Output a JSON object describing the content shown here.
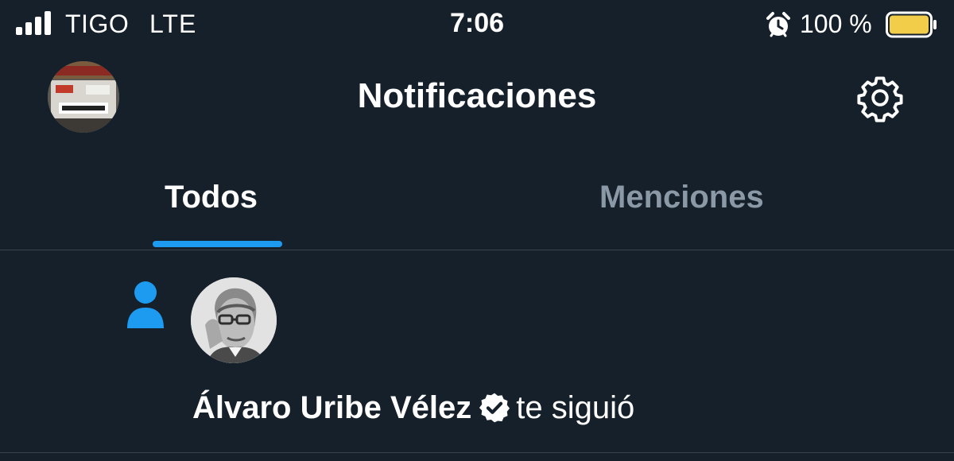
{
  "status_bar": {
    "carrier": "TIGO",
    "network": "LTE",
    "time": "7:06",
    "battery_percent": "100 %",
    "icons": [
      "signal-icon",
      "alarm-icon",
      "battery-icon"
    ]
  },
  "header": {
    "title": "Notificaciones",
    "avatar_icon": "profile-avatar",
    "settings_icon": "gear-icon"
  },
  "tabs": [
    {
      "label": "Todos",
      "selected": true
    },
    {
      "label": "Menciones",
      "selected": false
    }
  ],
  "notifications": [
    {
      "type_icon": "person-icon",
      "user_name": "Álvaro Uribe Vélez",
      "verified": true,
      "action": "te siguió"
    }
  ],
  "colors": {
    "background": "#15202b",
    "accent": "#1d9bf0",
    "muted_text": "#8b98a5",
    "divider": "#38444d",
    "battery": "#f2cd49"
  }
}
